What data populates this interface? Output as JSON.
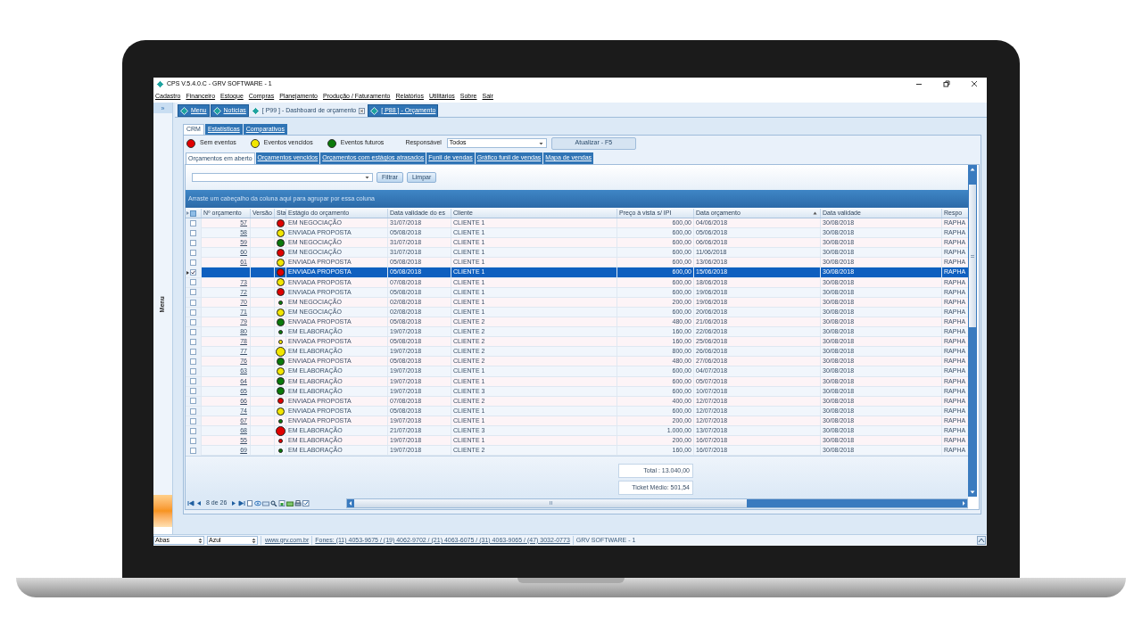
{
  "window": {
    "title": "CPS V.5.4.0.C - GRV SOFTWARE - 1"
  },
  "menu": [
    "Cadastro",
    "Financeiro",
    "Estoque",
    "Compras",
    "Planejamento",
    "Produção / Faturamento",
    "Relatórios",
    "Utilitários",
    "Sobre",
    "Sair"
  ],
  "sidebar": {
    "expand": "»",
    "label": "Menu"
  },
  "doc_tabs": [
    {
      "label": "Menu",
      "selected": false,
      "closable": false
    },
    {
      "label": "Notícias",
      "selected": false,
      "closable": false
    },
    {
      "label": "[ P99 ] - Dashboard de orçamento",
      "selected": true,
      "closable": true
    },
    {
      "label": "[ P88 ] - Orçamento",
      "selected": false,
      "closable": false
    }
  ],
  "view_tabs": [
    {
      "label": "CRM",
      "selected": true
    },
    {
      "label": "Estatísticas",
      "selected": false
    },
    {
      "label": "Comparativos",
      "selected": false
    }
  ],
  "legend": [
    {
      "label": "Sem eventos",
      "color": "#e00000"
    },
    {
      "label": "Eventos vencidos",
      "color": "#f2e600"
    },
    {
      "label": "Eventos futuros",
      "color": "#0a7a0a"
    }
  ],
  "responsible": {
    "label": "Responsável",
    "value": "Todos"
  },
  "refresh_button": "Atualizar - F5",
  "sub_tabs": [
    {
      "label": "Orçamentos em aberto",
      "selected": true
    },
    {
      "label": "Orçamentos vencidos",
      "selected": false
    },
    {
      "label": "Orçamentos com estágios atrasados",
      "selected": false
    },
    {
      "label": "Funil de vendas",
      "selected": false
    },
    {
      "label": "Gráfico funil de vendas",
      "selected": false
    },
    {
      "label": "Mapa de vendas",
      "selected": false
    }
  ],
  "filter": {
    "buttons": [
      "Filtrar",
      "Limpar"
    ]
  },
  "group_hint": "Arraste um cabeçalho da coluna aqui para agrupar por essa coluna",
  "table": {
    "columns": [
      {
        "label": "Nº orçamento",
        "sorted_ascending": false
      },
      {
        "label": "Versão",
        "sorted_ascending": false
      },
      {
        "label": "Sta",
        "sorted_ascending": false
      },
      {
        "label": "Estágio do orçamento",
        "sorted_ascending": false
      },
      {
        "label": "Data validade do es",
        "sorted_ascending": false
      },
      {
        "label": "Cliente",
        "sorted_ascending": false
      },
      {
        "label": "Preço à vista s/ IPI",
        "sorted_ascending": false
      },
      {
        "label": "Data orçamento",
        "sorted_ascending": true
      },
      {
        "label": "Data validade",
        "sorted_ascending": false
      },
      {
        "label": "Respo",
        "sorted_ascending": false
      }
    ],
    "rows": [
      {
        "selected": false,
        "checked": false,
        "number": "57",
        "color": "#e00000",
        "kind": "large",
        "stage": "EM NEGOCIAÇÃO",
        "stage_deadline": "31/07/2018",
        "client": "CLIENTE 1",
        "price": "600,00",
        "date": "04/06/2018",
        "validity": "30/08/2018",
        "owner": "RAPHA"
      },
      {
        "selected": false,
        "checked": false,
        "number": "58",
        "color": "#f2e600",
        "kind": "large",
        "stage": "ENVIADA PROPOSTA",
        "stage_deadline": "05/08/2018",
        "client": "CLIENTE 1",
        "price": "600,00",
        "date": "05/06/2018",
        "validity": "30/08/2018",
        "owner": "RAPHA"
      },
      {
        "selected": false,
        "checked": false,
        "number": "59",
        "color": "#0a7a0a",
        "kind": "large",
        "stage": "EM NEGOCIAÇÃO",
        "stage_deadline": "31/07/2018",
        "client": "CLIENTE 1",
        "price": "600,00",
        "date": "06/06/2018",
        "validity": "30/08/2018",
        "owner": "RAPHA"
      },
      {
        "selected": false,
        "checked": false,
        "number": "60",
        "color": "#e00000",
        "kind": "large",
        "stage": "EM NEGOCIAÇÃO",
        "stage_deadline": "31/07/2018",
        "client": "CLIENTE 1",
        "price": "600,00",
        "date": "11/06/2018",
        "validity": "30/08/2018",
        "owner": "RAPHA"
      },
      {
        "selected": false,
        "checked": false,
        "number": "61",
        "color": "#f2e600",
        "kind": "large",
        "stage": "ENVIADA PROPOSTA",
        "stage_deadline": "05/08/2018",
        "client": "CLIENTE 1",
        "price": "600,00",
        "date": "13/06/2018",
        "validity": "30/08/2018",
        "owner": "RAPHA"
      },
      {
        "selected": true,
        "checked": true,
        "color": "#e00000",
        "kind": "large",
        "stage": "ENVIADA PROPOSTA",
        "stage_deadline": "05/08/2018",
        "client": "CLIENTE 1",
        "price": "600,00",
        "date": "15/06/2018",
        "validity": "30/08/2018",
        "owner": "RAPHA"
      },
      {
        "selected": false,
        "checked": false,
        "number": "73",
        "color": "#f2e600",
        "kind": "large",
        "stage": "ENVIADA PROPOSTA",
        "stage_deadline": "07/08/2018",
        "client": "CLIENTE 1",
        "price": "600,00",
        "date": "18/06/2018",
        "validity": "30/08/2018",
        "owner": "RAPHA"
      },
      {
        "selected": false,
        "checked": false,
        "number": "72",
        "color": "#e00000",
        "kind": "large",
        "stage": "ENVIADA PROPOSTA",
        "stage_deadline": "05/08/2018",
        "client": "CLIENTE 1",
        "price": "600,00",
        "date": "19/06/2018",
        "validity": "30/08/2018",
        "owner": "RAPHA"
      },
      {
        "selected": false,
        "checked": false,
        "number": "70",
        "color": "#0a7a0a",
        "kind": "small",
        "stage": "EM NEGOCIAÇÃO",
        "stage_deadline": "02/08/2018",
        "client": "CLIENTE 1",
        "price": "200,00",
        "date": "19/06/2018",
        "validity": "30/08/2018",
        "owner": "RAPHA"
      },
      {
        "selected": false,
        "checked": false,
        "number": "71",
        "color": "#f2e600",
        "kind": "large",
        "stage": "EM NEGOCIAÇÃO",
        "stage_deadline": "02/08/2018",
        "client": "CLIENTE 1",
        "price": "600,00",
        "date": "20/06/2018",
        "validity": "30/08/2018",
        "owner": "RAPHA"
      },
      {
        "selected": false,
        "checked": false,
        "number": "79",
        "color": "#0a7a0a",
        "kind": "large",
        "stage": "ENVIADA PROPOSTA",
        "stage_deadline": "05/08/2018",
        "client": "CLIENTE 2",
        "price": "480,00",
        "date": "21/06/2018",
        "validity": "30/08/2018",
        "owner": "RAPHA"
      },
      {
        "selected": false,
        "checked": false,
        "number": "80",
        "color": "#0a7a0a",
        "kind": "small",
        "stage": "EM ELABORAÇÃO",
        "stage_deadline": "19/07/2018",
        "client": "CLIENTE 2",
        "price": "160,00",
        "date": "22/06/2018",
        "validity": "30/08/2018",
        "owner": "RAPHA"
      },
      {
        "selected": false,
        "checked": false,
        "number": "78",
        "color": "#f2e600",
        "kind": "small",
        "stage": "ENVIADA PROPOSTA",
        "stage_deadline": "05/08/2018",
        "client": "CLIENTE 2",
        "price": "160,00",
        "date": "25/06/2018",
        "validity": "30/08/2018",
        "owner": "RAPHA"
      },
      {
        "selected": false,
        "checked": false,
        "number": "77",
        "color": "#f2e600",
        "kind": "huge",
        "stage": "EM ELABORAÇÃO",
        "stage_deadline": "19/07/2018",
        "client": "CLIENTE 2",
        "price": "800,00",
        "date": "26/06/2018",
        "validity": "30/08/2018",
        "owner": "RAPHA"
      },
      {
        "selected": false,
        "checked": false,
        "number": "76",
        "color": "#0a7a0a",
        "kind": "large",
        "stage": "ENVIADA PROPOSTA",
        "stage_deadline": "05/08/2018",
        "client": "CLIENTE 2",
        "price": "480,00",
        "date": "27/06/2018",
        "validity": "30/08/2018",
        "owner": "RAPHA"
      },
      {
        "selected": false,
        "checked": false,
        "number": "63",
        "color": "#f2e600",
        "kind": "large",
        "stage": "EM ELABORAÇÃO",
        "stage_deadline": "19/07/2018",
        "client": "CLIENTE 1",
        "price": "600,00",
        "date": "04/07/2018",
        "validity": "30/08/2018",
        "owner": "RAPHA"
      },
      {
        "selected": false,
        "checked": false,
        "number": "64",
        "color": "#0a7a0a",
        "kind": "large",
        "stage": "EM ELABORAÇÃO",
        "stage_deadline": "19/07/2018",
        "client": "CLIENTE 1",
        "price": "600,00",
        "date": "05/07/2018",
        "validity": "30/08/2018",
        "owner": "RAPHA"
      },
      {
        "selected": false,
        "checked": false,
        "number": "65",
        "color": "#0a7a0a",
        "kind": "large",
        "stage": "EM ELABORAÇÃO",
        "stage_deadline": "19/07/2018",
        "client": "CLIENTE 3",
        "price": "600,00",
        "date": "10/07/2018",
        "validity": "30/08/2018",
        "owner": "RAPHA"
      },
      {
        "selected": false,
        "checked": false,
        "number": "66",
        "color": "#e00000",
        "kind": "medium",
        "stage": "ENVIADA PROPOSTA",
        "stage_deadline": "07/08/2018",
        "client": "CLIENTE 2",
        "price": "400,00",
        "date": "12/07/2018",
        "validity": "30/08/2018",
        "owner": "RAPHA"
      },
      {
        "selected": false,
        "checked": false,
        "number": "74",
        "color": "#f2e600",
        "kind": "large",
        "stage": "ENVIADA PROPOSTA",
        "stage_deadline": "05/08/2018",
        "client": "CLIENTE 1",
        "price": "600,00",
        "date": "12/07/2018",
        "validity": "30/08/2018",
        "owner": "RAPHA"
      },
      {
        "selected": false,
        "checked": false,
        "number": "67",
        "color": "#0a7a0a",
        "kind": "small",
        "stage": "ENVIADA PROPOSTA",
        "stage_deadline": "19/07/2018",
        "client": "CLIENTE 1",
        "price": "200,00",
        "date": "12/07/2018",
        "validity": "30/08/2018",
        "owner": "RAPHA"
      },
      {
        "selected": false,
        "checked": false,
        "number": "68",
        "color": "#e00000",
        "kind": "huge",
        "stage": "EM ELABORAÇÃO",
        "stage_deadline": "21/07/2018",
        "client": "CLIENTE 3",
        "price": "1.000,00",
        "date": "13/07/2018",
        "validity": "30/08/2018",
        "owner": "RAPHA"
      },
      {
        "selected": false,
        "checked": false,
        "number": "55",
        "color": "#e00000",
        "kind": "small",
        "stage": "EM ELABORAÇÃO",
        "stage_deadline": "19/07/2018",
        "client": "CLIENTE 1",
        "price": "200,00",
        "date": "16/07/2018",
        "validity": "30/08/2018",
        "owner": "RAPHA"
      },
      {
        "selected": false,
        "checked": false,
        "number": "69",
        "color": "#0a7a0a",
        "kind": "small",
        "stage": "EM ELABORAÇÃO",
        "stage_deadline": "19/07/2018",
        "client": "CLIENTE 2",
        "price": "160,00",
        "date": "16/07/2018",
        "validity": "30/08/2018",
        "owner": "RAPHA"
      }
    ]
  },
  "totals": [
    "Total : 13.040,00",
    "Ticket Médio: 501,54"
  ],
  "pager": {
    "position": "8 de 26"
  },
  "status_bar": {
    "tabs_mode": "Abas",
    "theme": "Azul",
    "website": "www.grv.com.br",
    "phones": "Fones: (11) 4053-9675 / (19) 4062-9702 / (21) 4063-6075 / (31) 4063-9065 / (47) 3032-0773",
    "company": "GRV SOFTWARE - 1"
  }
}
